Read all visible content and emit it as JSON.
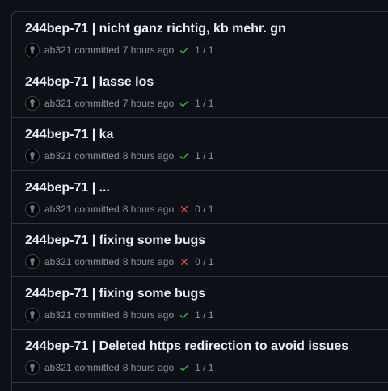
{
  "commits": [
    {
      "title": "244bep-71 | nicht ganz richtig, kb mehr. gn",
      "author": "ab321",
      "verb": "committed",
      "time": "7 hours ago",
      "status": "success",
      "checks": "1 / 1"
    },
    {
      "title": "244bep-71 | lasse los",
      "author": "ab321",
      "verb": "committed",
      "time": "7 hours ago",
      "status": "success",
      "checks": "1 / 1"
    },
    {
      "title": "244bep-71 | ka",
      "author": "ab321",
      "verb": "committed",
      "time": "8 hours ago",
      "status": "success",
      "checks": "1 / 1"
    },
    {
      "title": "244bep-71 | ...",
      "author": "ab321",
      "verb": "committed",
      "time": "8 hours ago",
      "status": "failure",
      "checks": "0 / 1"
    },
    {
      "title": "244bep-71 | fixing some bugs",
      "author": "ab321",
      "verb": "committed",
      "time": "8 hours ago",
      "status": "failure",
      "checks": "0 / 1"
    },
    {
      "title": "244bep-71 | fixing some bugs",
      "author": "ab321",
      "verb": "committed",
      "time": "8 hours ago",
      "status": "success",
      "checks": "1 / 1"
    },
    {
      "title": "244bep-71 | Deleted https redirection to avoid issues",
      "author": "ab321",
      "verb": "committed",
      "time": "8 hours ago",
      "status": "success",
      "checks": "1 / 1"
    }
  ],
  "colors": {
    "success": "#3fb950",
    "failure": "#f85149"
  }
}
